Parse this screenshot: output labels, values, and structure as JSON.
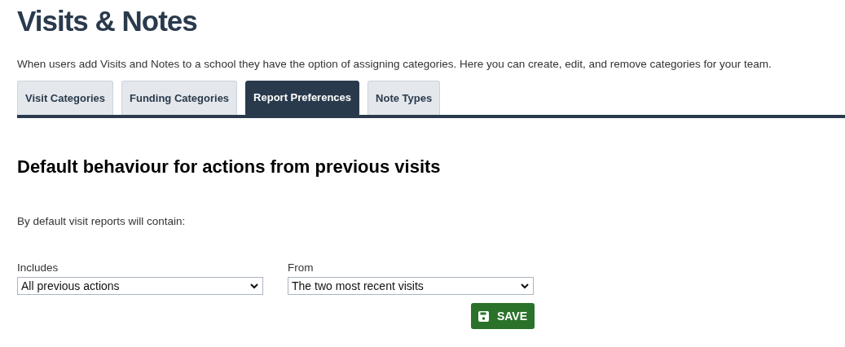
{
  "page": {
    "title": "Visits & Notes",
    "description": "When users add Visits and Notes to a school they have the option of assigning categories. Here you can create, edit, and remove categories for your team."
  },
  "tabs": [
    {
      "label": "Visit Categories",
      "selected": false
    },
    {
      "label": "Funding Categories",
      "selected": false
    },
    {
      "label": "Report Preferences",
      "selected": true
    },
    {
      "label": "Note Types",
      "selected": false
    }
  ],
  "section": {
    "heading": "Default behaviour for actions from previous visits",
    "intro": "By default visit reports will contain:"
  },
  "fields": [
    {
      "label": "Includes",
      "value": "All previous actions"
    },
    {
      "label": "From",
      "value": "The two most recent visits"
    }
  ],
  "save_button": {
    "label": "SAVE"
  }
}
